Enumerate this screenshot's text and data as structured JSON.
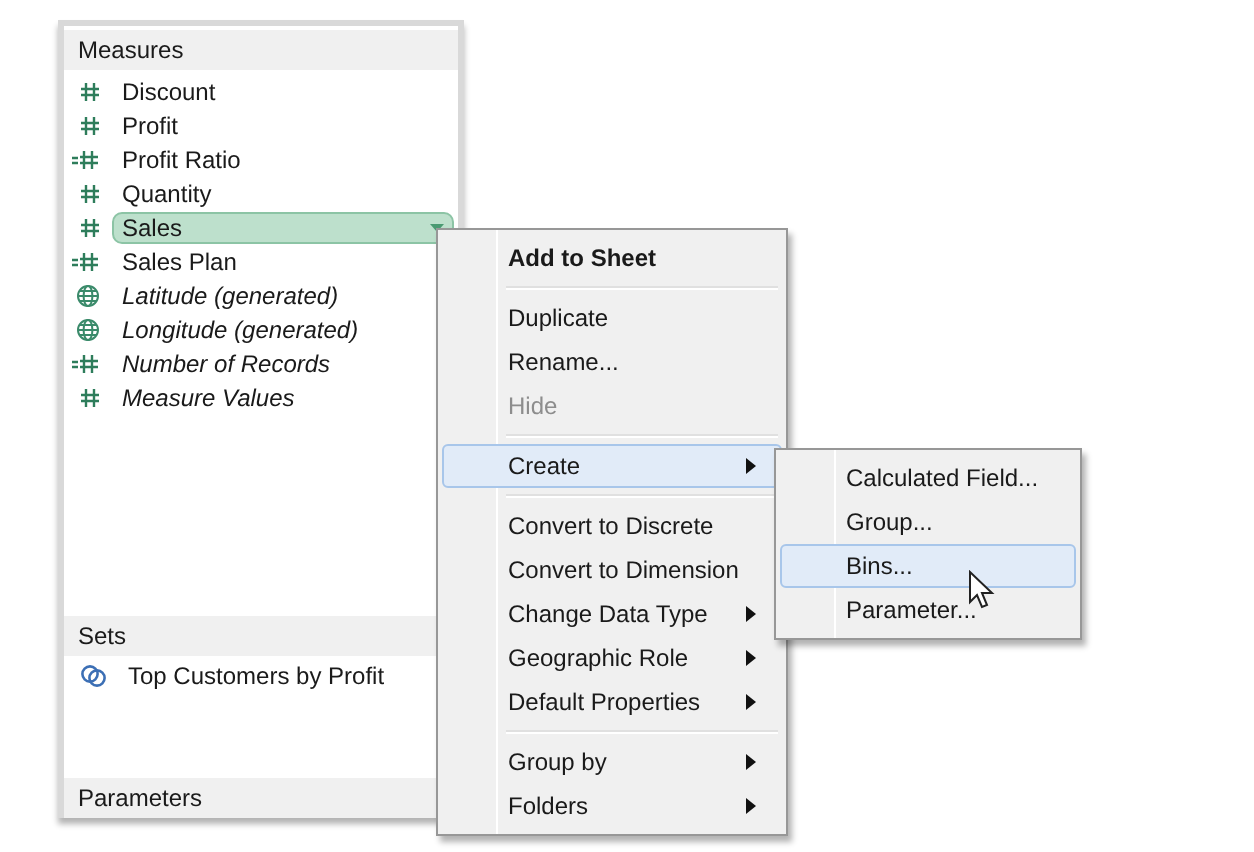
{
  "measures": {
    "title": "Measures",
    "items": [
      {
        "label": "Discount",
        "kind": "number",
        "generated": false,
        "selected": false
      },
      {
        "label": "Profit",
        "kind": "number",
        "generated": false,
        "selected": false
      },
      {
        "label": "Profit Ratio",
        "kind": "calc",
        "generated": false,
        "selected": false
      },
      {
        "label": "Quantity",
        "kind": "number",
        "generated": false,
        "selected": false
      },
      {
        "label": "Sales",
        "kind": "number",
        "generated": false,
        "selected": true
      },
      {
        "label": "Sales Plan",
        "kind": "calc",
        "generated": false,
        "selected": false
      },
      {
        "label": "Latitude (generated)",
        "kind": "geo",
        "generated": true,
        "selected": false
      },
      {
        "label": "Longitude (generated)",
        "kind": "geo",
        "generated": true,
        "selected": false
      },
      {
        "label": "Number of Records",
        "kind": "calc",
        "generated": true,
        "selected": false
      },
      {
        "label": "Measure Values",
        "kind": "number",
        "generated": true,
        "selected": false
      }
    ]
  },
  "sets": {
    "title": "Sets",
    "items": [
      {
        "label": "Top Customers by Profit"
      }
    ]
  },
  "parameters": {
    "title": "Parameters"
  },
  "context_menu": {
    "items": [
      {
        "kind": "item",
        "label": "Add to Sheet",
        "default": true,
        "disabled": false,
        "selected": false,
        "submenu": false
      },
      {
        "kind": "separator"
      },
      {
        "kind": "item",
        "label": "Duplicate",
        "default": false,
        "disabled": false,
        "selected": false,
        "submenu": false
      },
      {
        "kind": "item",
        "label": "Rename...",
        "default": false,
        "disabled": false,
        "selected": false,
        "submenu": false
      },
      {
        "kind": "item",
        "label": "Hide",
        "default": false,
        "disabled": true,
        "selected": false,
        "submenu": false
      },
      {
        "kind": "separator"
      },
      {
        "kind": "item",
        "label": "Create",
        "default": false,
        "disabled": false,
        "selected": true,
        "submenu": true
      },
      {
        "kind": "separator"
      },
      {
        "kind": "item",
        "label": "Convert to Discrete",
        "default": false,
        "disabled": false,
        "selected": false,
        "submenu": false
      },
      {
        "kind": "item",
        "label": "Convert to Dimension",
        "default": false,
        "disabled": false,
        "selected": false,
        "submenu": false
      },
      {
        "kind": "item",
        "label": "Change Data Type",
        "default": false,
        "disabled": false,
        "selected": false,
        "submenu": true
      },
      {
        "kind": "item",
        "label": "Geographic Role",
        "default": false,
        "disabled": false,
        "selected": false,
        "submenu": true
      },
      {
        "kind": "item",
        "label": "Default Properties",
        "default": false,
        "disabled": false,
        "selected": false,
        "submenu": true
      },
      {
        "kind": "separator"
      },
      {
        "kind": "item",
        "label": "Group by",
        "default": false,
        "disabled": false,
        "selected": false,
        "submenu": true
      },
      {
        "kind": "item",
        "label": "Folders",
        "default": false,
        "disabled": false,
        "selected": false,
        "submenu": true
      }
    ]
  },
  "submenu": {
    "items": [
      {
        "label": "Calculated Field...",
        "selected": false
      },
      {
        "label": "Group...",
        "selected": false
      },
      {
        "label": "Bins...",
        "selected": true
      },
      {
        "label": "Parameter...",
        "selected": false
      }
    ]
  }
}
